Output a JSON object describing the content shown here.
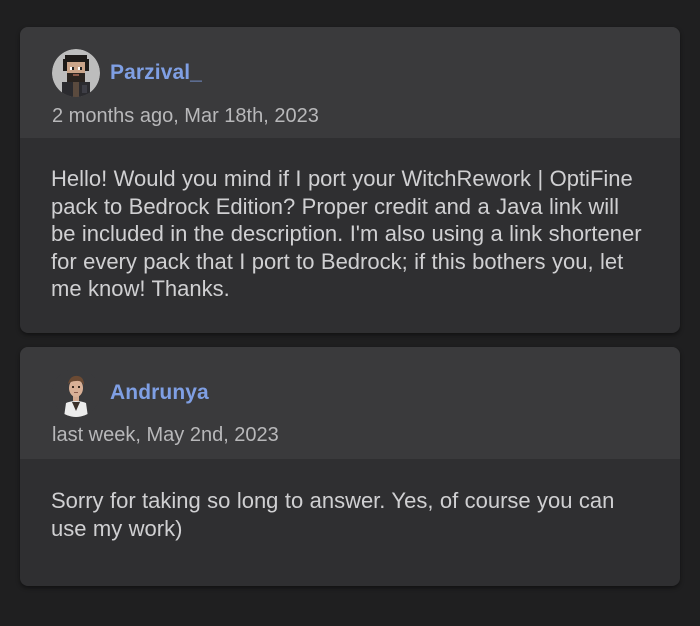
{
  "comments": [
    {
      "author": "Parzival_",
      "avatar_icon": "pixel-bearded-man-avatar",
      "timestamp": "2 months ago, Mar 18th, 2023",
      "body": "Hello! Would you mind if I port your WitchRework | OptiFine pack to Bedrock Edition? Proper credit and a Java link will be included in the description. I'm also using a link shortener for every pack that I port to Bedrock; if this bothers you, let me know! Thanks."
    },
    {
      "author": "Andrunya",
      "avatar_icon": "cartoon-man-avatar",
      "timestamp": "last week, May 2nd, 2023",
      "body": "Sorry for taking so long to answer. Yes, of course you can use my work)"
    }
  ],
  "colors": {
    "background": "#1f1f20",
    "card": "#2f2f31",
    "card_header": "#3a3a3c",
    "author_link": "#7f9fe4",
    "timestamp": "#b8b8ba",
    "body_text": "#d0d0d2"
  }
}
